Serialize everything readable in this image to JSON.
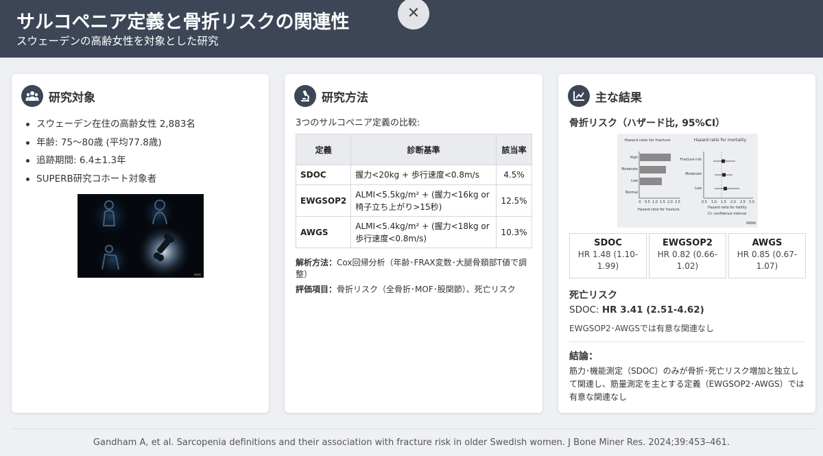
{
  "header": {
    "title": "サルコペニア定義と骨折リスクの関連性",
    "subtitle": "スウェーデンの高齢女性を対象とした研究",
    "close_label": "✕"
  },
  "subjects": {
    "title": "研究対象",
    "items": [
      "スウェーデン在住の高齢女性 2,883名",
      "年齢: 75～80歳 (平均77.8歳)",
      "追跡期間: 6.4±1.3年",
      "SUPERB研究コホート対象者"
    ]
  },
  "methods": {
    "title": "研究方法",
    "intro": "3つのサルコペニア定義の比較:",
    "table": {
      "headers": [
        "定義",
        "診断基準",
        "該当率"
      ],
      "rows": [
        {
          "name": "SDOC",
          "criteria": "握力<20kg + 歩行速度<0.8m/s",
          "rate": "4.5%"
        },
        {
          "name": "EWGSOP2",
          "criteria": "ALMI<5.5kg/m² + (握力<16kg or 椅子立ち上がり>15秒)",
          "rate": "12.5%"
        },
        {
          "name": "AWGS",
          "criteria": "ALMI<5.4kg/m² + (握力<18kg or 歩行速度<0.8m/s)",
          "rate": "10.3%"
        }
      ]
    },
    "analysis_label": "解析方法：",
    "analysis_text": "Cox回帰分析（年齢･FRAX変数･大腿骨頚部T値で調整）",
    "outcome_label": "評価項目：",
    "outcome_text": "骨折リスク（全骨折･MOF･股関節）、死亡リスク"
  },
  "results": {
    "title": "主な結果",
    "fracture_label": "骨折リスク（ハザード比, 95%CI）",
    "figure": {
      "left_title": "Hazard ratio for fracture",
      "right_title": "Hazard ratio for mortality",
      "left_rows": [
        "High",
        "Moderate",
        "Low",
        "Normal"
      ],
      "right_rows": [
        "Fracture risk",
        "Moderate",
        "Low"
      ],
      "left_ticks": [
        "0",
        "0.5",
        "1.0",
        "1.5",
        "2.0",
        "2.5"
      ],
      "right_ticks": [
        "0.5",
        "1.0",
        "1.5",
        "2.0",
        "2.5",
        "3.0"
      ],
      "left_xlabel": "Hazard ratio for fracture",
      "right_xlabel": "Hazard ratio for fatility",
      "ci_note": "CI: confidence interval"
    },
    "hr": [
      {
        "name": "SDOC",
        "value": "HR 1.48 (1.10-1.99)"
      },
      {
        "name": "EWGSOP2",
        "value": "HR 0.82 (0.66-1.02)"
      },
      {
        "name": "AWGS",
        "value": "HR 0.85 (0.67-1.07)"
      }
    ],
    "mortality_label": "死亡リスク",
    "mortality_prefix": "SDOC: ",
    "mortality_value": "HR 3.41 (2.51-4.62)",
    "mortality_note": "EWGSOP2･AWGSでは有意な関連なし",
    "conclusion_label": "結論：",
    "conclusion_text": "筋力･機能測定（SDOC）のみが骨折･死亡リスク増加と独立して関連し、筋量測定を主とする定義（EWGSOP2･AWGS）では有意な関連なし"
  },
  "footer": {
    "citation": "Gandham A, et al. Sarcopenia definitions and their association with fracture risk in older Swedish women. J Bone Miner Res. 2024;39:453–461."
  },
  "colors": {
    "header_bg": "#3c4656",
    "page_bg": "#eef0f3",
    "card_bg": "#ffffff",
    "icon_circle": "#3c4656"
  }
}
